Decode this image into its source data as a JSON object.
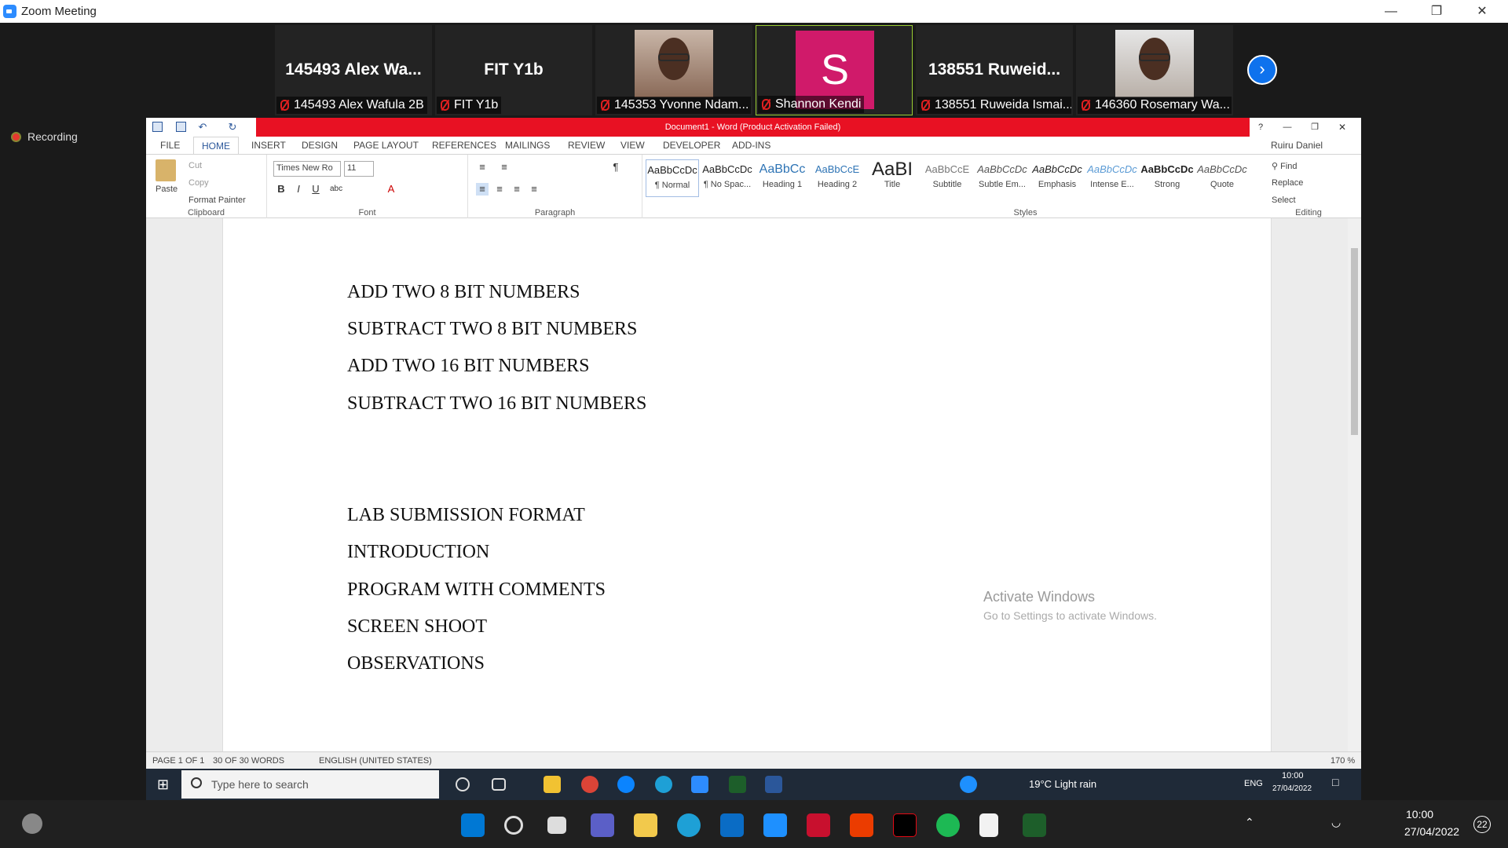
{
  "zoom": {
    "title": "Zoom Meeting",
    "recording_label": "Recording",
    "participants": [
      {
        "display": "145493  Alex  Wa...",
        "name": "145493 Alex Wafula 2B",
        "type": "text"
      },
      {
        "display": "FIT Y1b",
        "name": "FIT Y1b",
        "type": "text"
      },
      {
        "display": "",
        "name": "145353 Yvonne Ndam...",
        "type": "photo"
      },
      {
        "display": "S",
        "name": "Shannon Kendi",
        "type": "avatar",
        "avatar_color": "#D01A6A",
        "active_speaker": true
      },
      {
        "display": "138551  Ruweid...",
        "name": "138551 Ruweida Ismai...",
        "type": "text"
      },
      {
        "display": "",
        "name": "146360 Rosemary Wa...",
        "type": "photo"
      }
    ]
  },
  "word": {
    "title": "Document1 - Word (Product Activation Failed)",
    "user": "Ruiru Daniel",
    "tabs": [
      "FILE",
      "HOME",
      "INSERT",
      "DESIGN",
      "PAGE LAYOUT",
      "REFERENCES",
      "MAILINGS",
      "REVIEW",
      "VIEW",
      "DEVELOPER",
      "ADD-INS"
    ],
    "active_tab": "HOME",
    "clipboard": {
      "paste": "Paste",
      "cut": "Cut",
      "copy": "Copy",
      "format_painter": "Format Painter",
      "label": "Clipboard"
    },
    "font": {
      "name": "Times New Ro",
      "size": "11",
      "label": "Font"
    },
    "paragraph_label": "Paragraph",
    "styles": [
      {
        "sample": "AaBbCcDc",
        "name": "¶ Normal"
      },
      {
        "sample": "AaBbCcDc",
        "name": "¶ No Spac..."
      },
      {
        "sample": "AaBbCc",
        "name": "Heading 1"
      },
      {
        "sample": "AaBbCcE",
        "name": "Heading 2"
      },
      {
        "sample": "AaBI",
        "name": "Title"
      },
      {
        "sample": "AaBbCcE",
        "name": "Subtitle"
      },
      {
        "sample": "AaBbCcDc",
        "name": "Subtle Em..."
      },
      {
        "sample": "AaBbCcDc",
        "name": "Emphasis"
      },
      {
        "sample": "AaBbCcDc",
        "name": "Intense E..."
      },
      {
        "sample": "AaBbCcDc",
        "name": "Strong"
      },
      {
        "sample": "AaBbCcDc",
        "name": "Quote"
      }
    ],
    "styles_label": "Styles",
    "editing": {
      "find": "Find",
      "replace": "Replace",
      "select": "Select",
      "label": "Editing"
    },
    "document_lines": [
      "ADD TWO 8 BIT NUMBERS",
      "SUBTRACT TWO 8 BIT NUMBERS",
      "ADD TWO 16 BIT NUMBERS",
      "SUBTRACT TWO 16 BIT NUMBERS",
      "LAB SUBMISSION FORMAT",
      "INTRODUCTION",
      "PROGRAM WITH COMMENTS",
      "SCREEN SHOOT",
      "OBSERVATIONS"
    ],
    "watermark": {
      "title": "Activate Windows",
      "subtitle": "Go to Settings to activate Windows."
    },
    "status": {
      "page": "PAGE 1 OF 1",
      "words": "30 OF 30 WORDS",
      "language": "ENGLISH (UNITED STATES)",
      "zoom": "170 %"
    }
  },
  "inner_taskbar": {
    "search_placeholder": "Type here to search",
    "weather": "19°C  Light rain",
    "lang": "ENG",
    "time": "10:00",
    "date": "27/04/2022"
  },
  "outer_taskbar": {
    "time": "10:00",
    "date": "27/04/2022",
    "notifications": "22"
  }
}
